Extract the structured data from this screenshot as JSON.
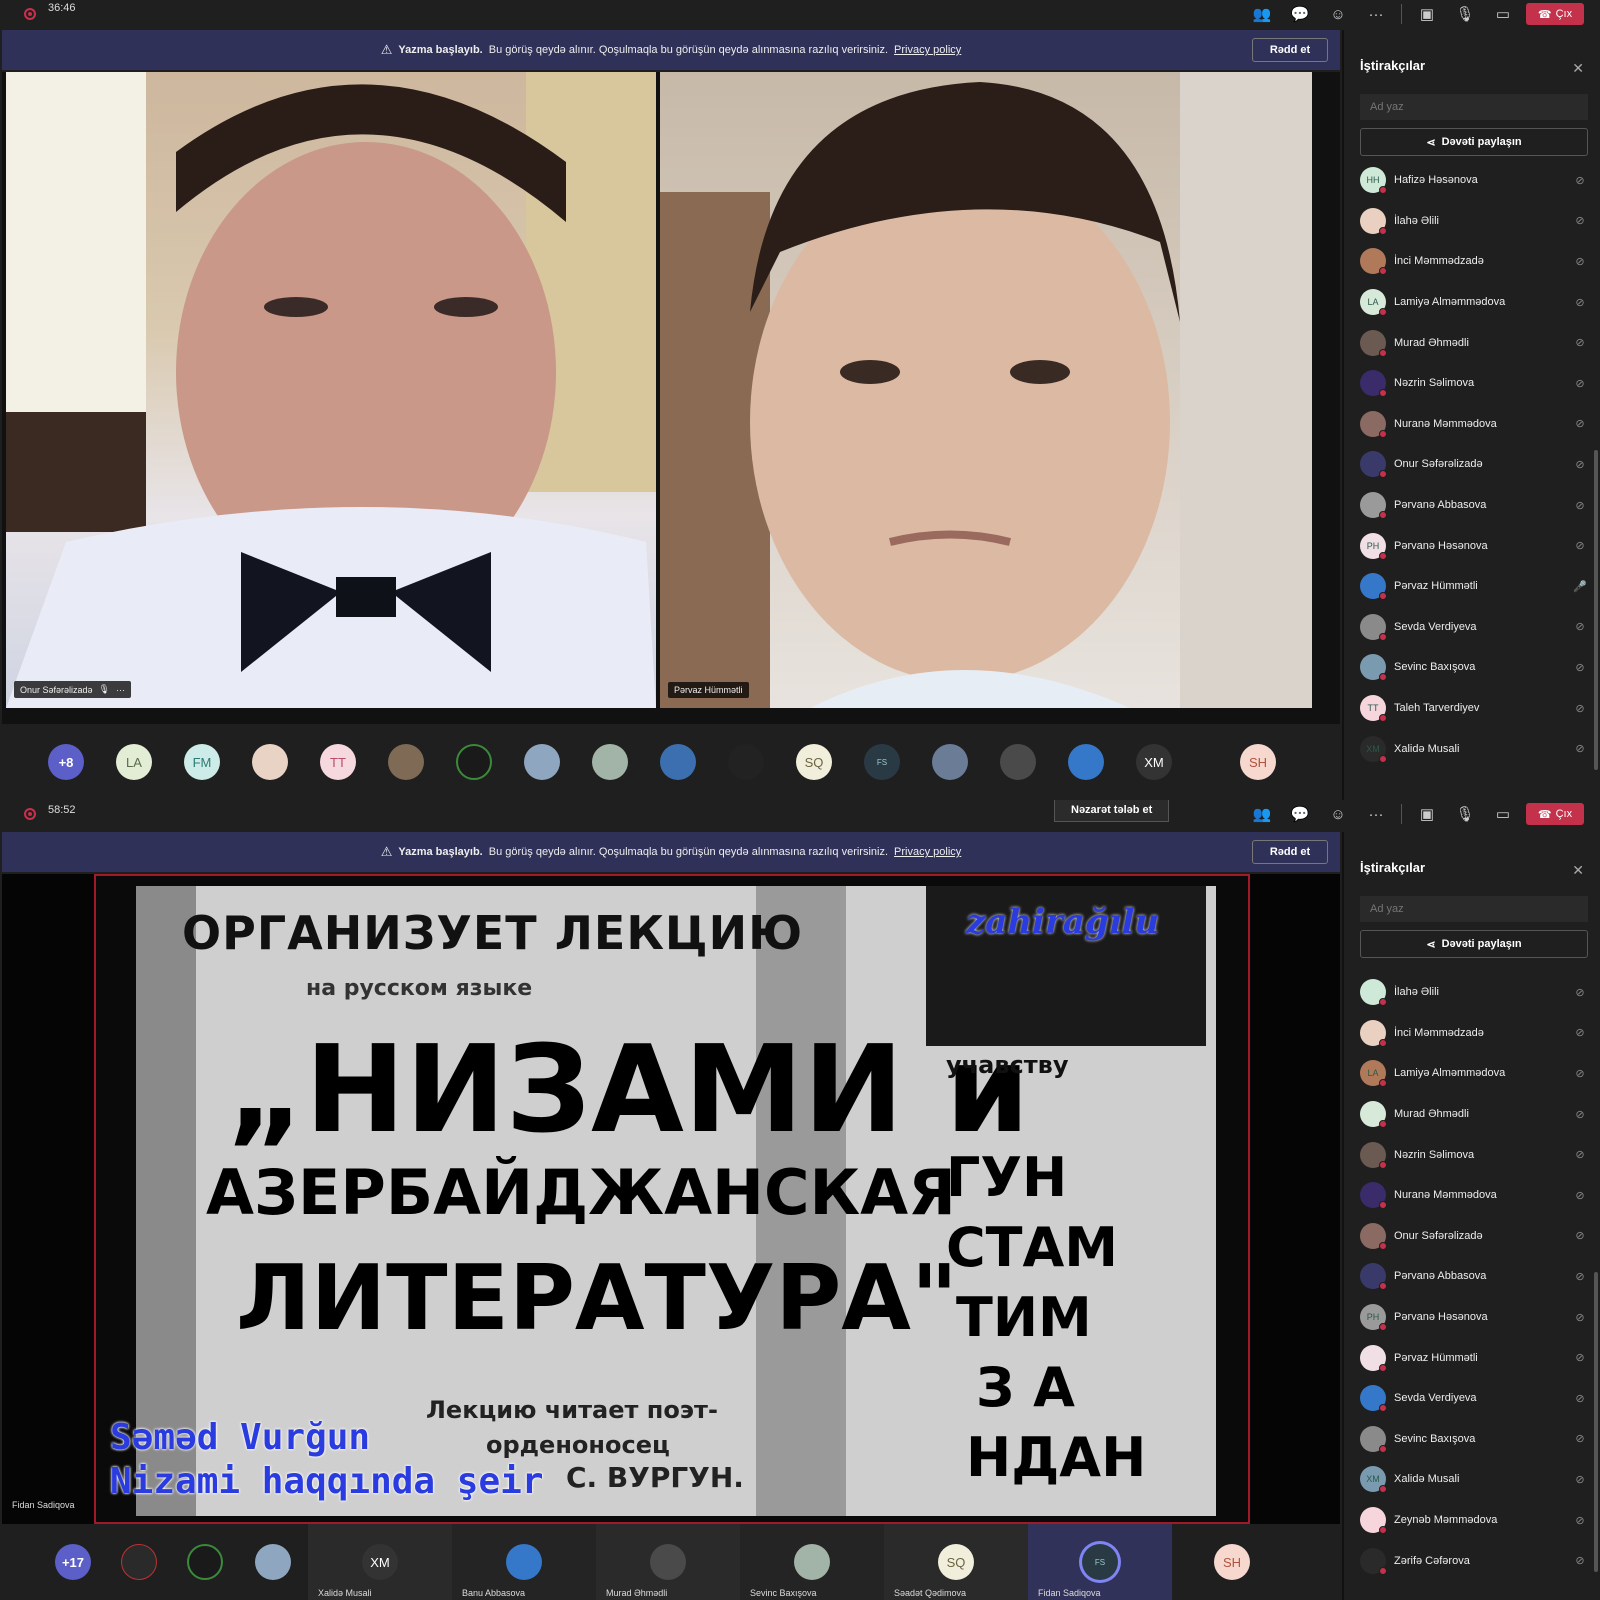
{
  "screens": [
    {
      "timer": "36:46",
      "banner": {
        "title": "Yazma başlayıb.",
        "message": "Bu görüş qeydə alınır. Qoşulmaqla bu görüşün qeydə alınmasına razılıq verirsiniz.",
        "link": "Privacy policy",
        "dismiss": "Rədd et"
      },
      "toolbar": {
        "leave": "Çıx"
      },
      "videos": [
        {
          "name": "Onur Səfərəlizadə"
        },
        {
          "name": "Pərvaz Hümmətli"
        }
      ],
      "strip": [
        "+8",
        "LA",
        "FM",
        "",
        "TT",
        "",
        "",
        "",
        "",
        "",
        "",
        "SQ",
        "FS",
        "",
        "",
        "",
        "XM",
        "SH"
      ],
      "sidebar": {
        "title": "İştirakçılar",
        "search_placeholder": "Ad yaz",
        "share": "Dəvəti paylaşın",
        "participants": [
          {
            "name": "Hafizə Həsənova",
            "initials": "HH",
            "mic": "muted"
          },
          {
            "name": "İlahə Əlili",
            "initials": "",
            "mic": "muted"
          },
          {
            "name": "İnci Məmmədzadə",
            "initials": "",
            "mic": "muted"
          },
          {
            "name": "Lamiyə Alməmmədova",
            "initials": "LA",
            "mic": "muted"
          },
          {
            "name": "Murad Əhmədli",
            "initials": "",
            "mic": "muted"
          },
          {
            "name": "Nəzrin Səlimova",
            "initials": "",
            "mic": "muted"
          },
          {
            "name": "Nuranə Məmmədova",
            "initials": "",
            "mic": "muted"
          },
          {
            "name": "Onur Səfərəlizadə",
            "initials": "",
            "mic": "muted"
          },
          {
            "name": "Pərvanə Abbasova",
            "initials": "",
            "mic": "muted"
          },
          {
            "name": "Pərvanə Həsənova",
            "initials": "PH",
            "mic": "muted"
          },
          {
            "name": "Pərvaz Hümmətli",
            "initials": "",
            "mic": "on"
          },
          {
            "name": "Sevda Verdiyeva",
            "initials": "",
            "mic": "muted"
          },
          {
            "name": "Sevinc Baxışova",
            "initials": "",
            "mic": "muted"
          },
          {
            "name": "Taleh Tarverdiyev",
            "initials": "TT",
            "mic": "muted"
          },
          {
            "name": "Xalidə Musali",
            "initials": "XM",
            "mic": "muted"
          }
        ]
      }
    },
    {
      "timer": "58:52",
      "control_request": "Nəzarət tələb et",
      "banner": {
        "title": "Yazma başlayıb.",
        "message": "Bu görüş qeydə alınır. Qoşulmaqla bu görüşün qeydə alınmasına razılıq verirsiniz.",
        "link": "Privacy policy",
        "dismiss": "Rədd et"
      },
      "toolbar": {
        "leave": "Çıx"
      },
      "presenter": "Fidan Sadiqova",
      "shared_video": {
        "poster_lines": [
          "ОРГАНИЗУЕТ ЛЕКЦИЮ",
          "на русском языке",
          "„НИЗАМИ и",
          "АЗЕРБАЙДЖАНСКАЯ",
          "ЛИТЕРАТУРА\"",
          "Лекцию читает поэт-",
          "орденоносец",
          "С. ВУРГУН.",
          "ГУН",
          "СТАМ",
          "ТИМ",
          "З А",
          "НДАН",
          "учавству"
        ],
        "watermark": "zahirağılu",
        "caption": [
          "Səməd Vurğun",
          "Nizami haqqında şeir"
        ]
      },
      "strip": [
        {
          "initials": "+17",
          "label": ""
        },
        {
          "initials": "",
          "label": ""
        },
        {
          "initials": "",
          "label": ""
        },
        {
          "initials": "",
          "label": ""
        },
        {
          "initials": "XM",
          "label": "Xalidə Musali"
        },
        {
          "initials": "",
          "label": "Banu Abbasova"
        },
        {
          "initials": "",
          "label": "Murad Əhmədli"
        },
        {
          "initials": "",
          "label": "Sevinc Baxışova"
        },
        {
          "initials": "SQ",
          "label": "Səadət Qədimova"
        },
        {
          "initials": "FS",
          "label": "Fidan Sadiqova"
        },
        {
          "initials": "SH",
          "label": ""
        }
      ],
      "sidebar": {
        "title": "İştirakçılar",
        "search_placeholder": "Ad yaz",
        "share": "Dəvəti paylaşın",
        "participants": [
          {
            "name": "İlahə Əlili",
            "initials": "",
            "mic": "muted"
          },
          {
            "name": "İnci Məmmədzadə",
            "initials": "",
            "mic": "muted"
          },
          {
            "name": "Lamiyə Alməmmədova",
            "initials": "LA",
            "mic": "muted"
          },
          {
            "name": "Murad Əhmədli",
            "initials": "",
            "mic": "muted"
          },
          {
            "name": "Nəzrin Səlimova",
            "initials": "",
            "mic": "muted"
          },
          {
            "name": "Nuranə Məmmədova",
            "initials": "",
            "mic": "muted"
          },
          {
            "name": "Onur Səfərəlizadə",
            "initials": "",
            "mic": "muted"
          },
          {
            "name": "Pərvanə Abbasova",
            "initials": "",
            "mic": "muted"
          },
          {
            "name": "Pərvanə Həsənova",
            "initials": "PH",
            "mic": "muted"
          },
          {
            "name": "Pərvaz Hümmətli",
            "initials": "",
            "mic": "muted"
          },
          {
            "name": "Sevda Verdiyeva",
            "initials": "",
            "mic": "muted"
          },
          {
            "name": "Sevinc Baxışova",
            "initials": "",
            "mic": "muted"
          },
          {
            "name": "Xalidə Musali",
            "initials": "XM",
            "mic": "muted"
          },
          {
            "name": "Zeynəb Məmmədova",
            "initials": "",
            "mic": "muted"
          },
          {
            "name": "Zərifə Cəfərova",
            "initials": "",
            "mic": "muted"
          }
        ]
      }
    }
  ],
  "colors": {
    "accent": "#c4314b",
    "banner": "#2f3159",
    "bg": "#1f1f1f"
  }
}
